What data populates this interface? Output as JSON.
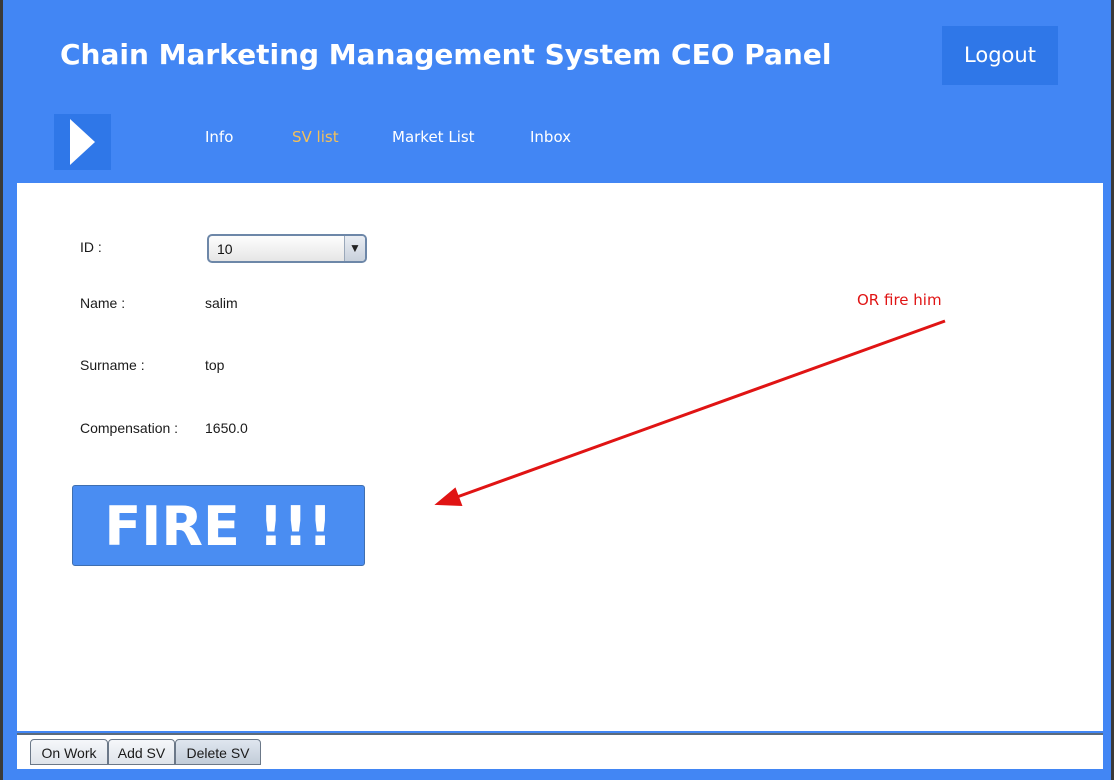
{
  "header": {
    "title": "Chain Marketing Management System CEO Panel",
    "logout_label": "Logout",
    "menu_icon": "play-triangle-icon"
  },
  "nav": {
    "items": [
      {
        "label": "Info",
        "active": false
      },
      {
        "label": "SV list",
        "active": true
      },
      {
        "label": "Market List",
        "active": false
      },
      {
        "label": "Inbox",
        "active": false
      }
    ]
  },
  "form": {
    "id_label": "ID :",
    "id_value": "10",
    "name_label": "Name :",
    "name_value": "salim",
    "surname_label": "Surname :",
    "surname_value": "top",
    "compensation_label": "Compensation :",
    "compensation_value": "1650.0"
  },
  "fire_button_label": "FIRE !!!",
  "annotation": {
    "text": "OR fire him",
    "color": "#e01414"
  },
  "tabs": [
    {
      "label": "On Work",
      "selected": false
    },
    {
      "label": "Add SV",
      "selected": false
    },
    {
      "label": "Delete SV",
      "selected": true
    }
  ],
  "colors": {
    "brand_blue": "#4286f4",
    "dark_blue": "#2f77e8",
    "active_nav": "#f3c05a",
    "fire_button": "#4a8df2"
  }
}
